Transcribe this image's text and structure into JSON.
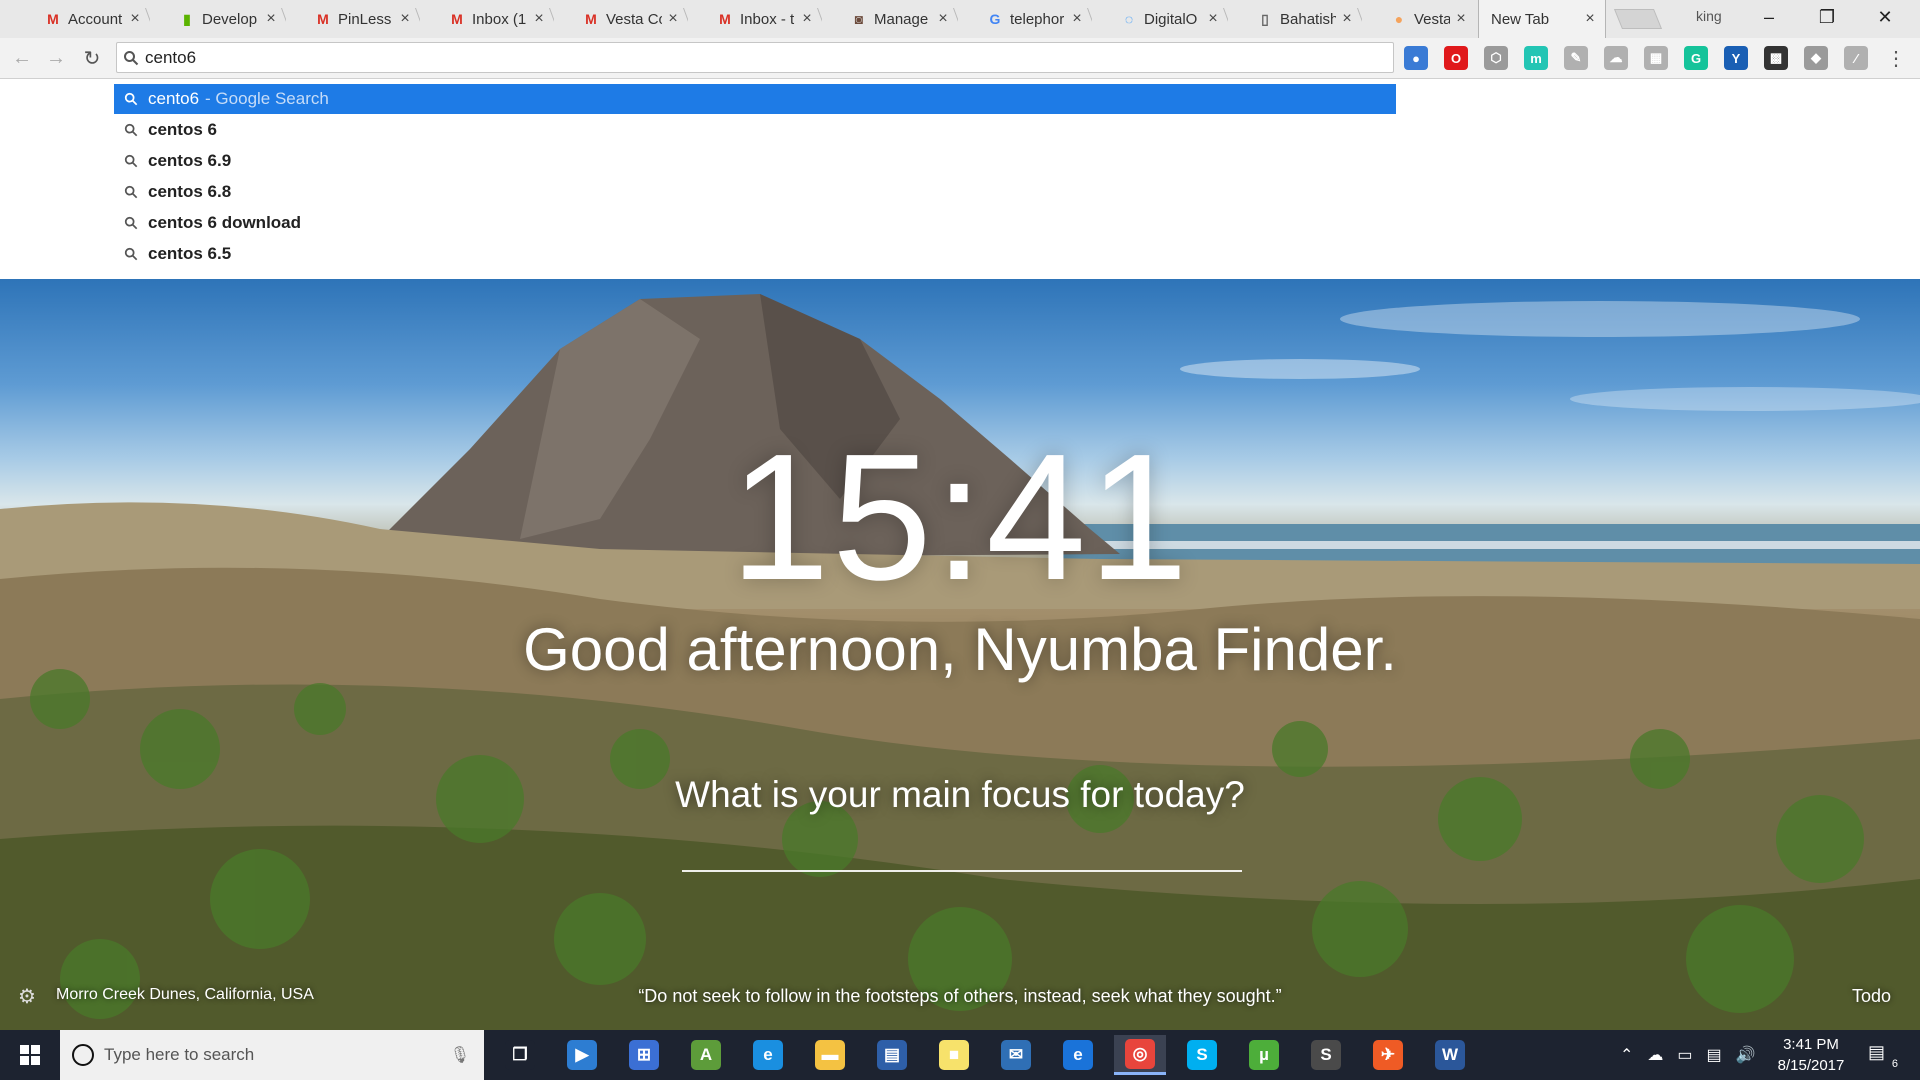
{
  "browser": {
    "tabs": [
      {
        "title": "Account",
        "favicon": "gmail-icon",
        "color": "#d93025"
      },
      {
        "title": "Develop",
        "favicon": "analytics-icon",
        "color": "#5bb300"
      },
      {
        "title": "PinLess",
        "favicon": "gmail-icon",
        "color": "#d93025"
      },
      {
        "title": "Inbox (1",
        "favicon": "gmail-icon",
        "color": "#d93025"
      },
      {
        "title": "Vesta Co",
        "favicon": "gmail-icon",
        "color": "#d93025"
      },
      {
        "title": "Inbox - t",
        "favicon": "gmail-icon",
        "color": "#d93025"
      },
      {
        "title": "Manage",
        "favicon": "manage-icon",
        "color": "#6b4a3b"
      },
      {
        "title": "telephor",
        "favicon": "google-icon",
        "color": "#4285f4"
      },
      {
        "title": "DigitalO",
        "favicon": "digitalocean-icon",
        "color": "#0080ff"
      },
      {
        "title": "Bahatish",
        "favicon": "document-icon",
        "color": "#666666"
      },
      {
        "title": "Vesta - V",
        "favicon": "vesta-icon",
        "color": "#f5a35c"
      },
      {
        "title": "New Tab",
        "favicon": "",
        "color": "#333333"
      }
    ],
    "profile_name": "king",
    "omnibox_value": "cento6",
    "extensions": [
      {
        "icon": "globe-extension-icon",
        "color": "#3a7bd5",
        "glyph": "●"
      },
      {
        "icon": "opera-extension-icon",
        "color": "#e0191b",
        "glyph": "O"
      },
      {
        "icon": "shield-extension-icon",
        "color": "#9a9a9a",
        "glyph": "⬡"
      },
      {
        "icon": "momentum-extension-icon",
        "color": "#23c5b4",
        "glyph": "m"
      },
      {
        "icon": "pencil-extension-icon",
        "color": "#b0b0b0",
        "glyph": "✎"
      },
      {
        "icon": "cloud-extension-icon",
        "color": "#b0b0b0",
        "glyph": "☁"
      },
      {
        "icon": "table-extension-icon",
        "color": "#b0b0b0",
        "glyph": "▦"
      },
      {
        "icon": "grammarly-extension-icon",
        "color": "#15c39a",
        "glyph": "G"
      },
      {
        "icon": "y-extension-icon",
        "color": "#1a5fb4",
        "glyph": "Y"
      },
      {
        "icon": "apps-grid-icon",
        "color": "#333333",
        "glyph": "▩"
      },
      {
        "icon": "puzzle-extension-icon",
        "color": "#9a9a9a",
        "glyph": "◆"
      },
      {
        "icon": "pdf-extension-icon",
        "color": "#b0b0b0",
        "glyph": "⁄"
      }
    ]
  },
  "suggestions": [
    {
      "text": "cento6",
      "sub": "- Google Search",
      "selected": true
    },
    {
      "text": "centos 6",
      "sub": "",
      "selected": false
    },
    {
      "text": "centos 6.9",
      "sub": "",
      "selected": false
    },
    {
      "text": "centos 6.8",
      "sub": "",
      "selected": false
    },
    {
      "text": "centos 6 download",
      "sub": "",
      "selected": false
    },
    {
      "text": "centos 6.5",
      "sub": "",
      "selected": false
    }
  ],
  "momentum": {
    "time": "15:41",
    "greeting": "Good afternoon, Nyumba Finder.",
    "focus_question": "What is your main focus for today?",
    "location": "Morro Creek Dunes, California, USA",
    "quote": "“Do not seek to follow in the footsteps of others, instead, seek what they sought.”",
    "todo_label": "Todo"
  },
  "taskbar": {
    "search_placeholder": "Type here to search",
    "apps": [
      {
        "icon": "task-view-icon",
        "color": "#1d2330",
        "glyph": "❐",
        "active": false
      },
      {
        "icon": "media-player-icon",
        "color": "#2d7dd2",
        "glyph": "▶",
        "active": false
      },
      {
        "icon": "network-app-icon",
        "color": "#3b6fd4",
        "glyph": "⊞",
        "active": false
      },
      {
        "icon": "android-studio-icon",
        "color": "#5d9c3a",
        "glyph": "A",
        "active": false
      },
      {
        "icon": "internet-explorer-icon",
        "color": "#1a8fe0",
        "glyph": "e",
        "active": false
      },
      {
        "icon": "file-explorer-icon",
        "color": "#f4c242",
        "glyph": "▬",
        "active": false
      },
      {
        "icon": "app-tiles-icon",
        "color": "#2e5fa8",
        "glyph": "▤",
        "active": false
      },
      {
        "icon": "sticky-notes-icon",
        "color": "#f7e26b",
        "glyph": "■",
        "active": false
      },
      {
        "icon": "thunderbird-icon",
        "color": "#2f6fb5",
        "glyph": "✉",
        "active": false
      },
      {
        "icon": "edge-icon",
        "color": "#1a73d9",
        "glyph": "e",
        "active": false
      },
      {
        "icon": "chrome-icon",
        "color": "#e8453c",
        "glyph": "◎",
        "active": true
      },
      {
        "icon": "skype-icon",
        "color": "#00aff0",
        "glyph": "S",
        "active": false
      },
      {
        "icon": "utorrent-icon",
        "color": "#4dae3a",
        "glyph": "µ",
        "active": false
      },
      {
        "icon": "sublime-text-icon",
        "color": "#4a4a4a",
        "glyph": "S",
        "active": false
      },
      {
        "icon": "postman-icon",
        "color": "#ef5b25",
        "glyph": "✈",
        "active": false
      },
      {
        "icon": "word-icon",
        "color": "#2b579a",
        "glyph": "W",
        "active": false
      }
    ],
    "clock_time": "3:41 PM",
    "clock_date": "8/15/2017",
    "notification_count": "6"
  }
}
